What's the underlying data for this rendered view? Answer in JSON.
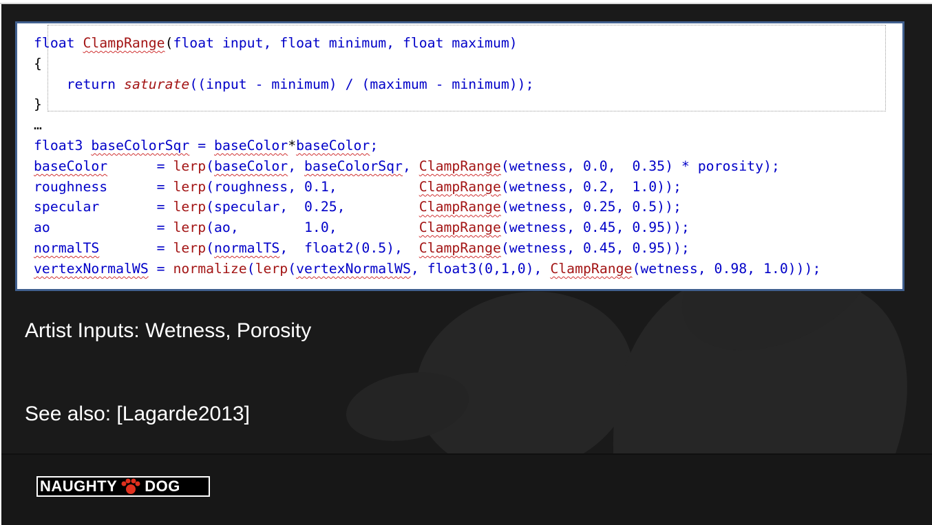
{
  "code": {
    "lines": [
      [
        {
          "t": "float",
          "c": "kw"
        },
        {
          "t": " ",
          "c": ""
        },
        {
          "t": "ClampRange",
          "c": "fn sq"
        },
        {
          "t": "(",
          "c": ""
        },
        {
          "t": "float",
          "c": "kw"
        },
        {
          "t": " input, ",
          "c": "kw"
        },
        {
          "t": "float",
          "c": "kw"
        },
        {
          "t": " minimum, ",
          "c": "kw"
        },
        {
          "t": "float",
          "c": "kw"
        },
        {
          "t": " maximum)",
          "c": "kw"
        }
      ],
      [
        {
          "t": "{",
          "c": ""
        }
      ],
      [
        {
          "t": "    ",
          "c": ""
        },
        {
          "t": "return",
          "c": "kw"
        },
        {
          "t": " ",
          "c": ""
        },
        {
          "t": "saturate",
          "c": "fn it"
        },
        {
          "t": "((input - minimum) / (maximum - minimum));",
          "c": "kw"
        }
      ],
      [
        {
          "t": "}",
          "c": ""
        }
      ],
      [
        {
          "t": "…",
          "c": ""
        }
      ],
      [
        {
          "t": "float3",
          "c": "kw"
        },
        {
          "t": " ",
          "c": ""
        },
        {
          "t": "baseColorSqr",
          "c": "kw sq"
        },
        {
          "t": " = ",
          "c": "kw"
        },
        {
          "t": "baseColor",
          "c": "kw sq"
        },
        {
          "t": "*",
          "c": ""
        },
        {
          "t": "baseColor",
          "c": "kw sq"
        },
        {
          "t": ";",
          "c": "kw"
        }
      ],
      [
        {
          "t": "baseColor",
          "c": "kw sq"
        },
        {
          "t": "      = ",
          "c": "kw"
        },
        {
          "t": "lerp",
          "c": "fn"
        },
        {
          "t": "(",
          "c": "kw"
        },
        {
          "t": "baseColor",
          "c": "kw sq"
        },
        {
          "t": ", ",
          "c": "kw"
        },
        {
          "t": "baseColorSqr",
          "c": "kw sq"
        },
        {
          "t": ", ",
          "c": "kw"
        },
        {
          "t": "ClampRange",
          "c": "fn sq"
        },
        {
          "t": "(wetness, 0.0,  0.35) * porosity);",
          "c": "kw"
        }
      ],
      [
        {
          "t": "roughness      = ",
          "c": "kw"
        },
        {
          "t": "lerp",
          "c": "fn"
        },
        {
          "t": "(roughness, 0.1,          ",
          "c": "kw"
        },
        {
          "t": "ClampRange",
          "c": "fn sq"
        },
        {
          "t": "(wetness, 0.2,  1.0));",
          "c": "kw"
        }
      ],
      [
        {
          "t": "specular       = ",
          "c": "kw"
        },
        {
          "t": "lerp",
          "c": "fn"
        },
        {
          "t": "(specular,  0.25,         ",
          "c": "kw"
        },
        {
          "t": "ClampRange",
          "c": "fn sq"
        },
        {
          "t": "(wetness, 0.25, 0.5));",
          "c": "kw"
        }
      ],
      [
        {
          "t": "ao             = ",
          "c": "kw"
        },
        {
          "t": "lerp",
          "c": "fn"
        },
        {
          "t": "(ao,        1.0,          ",
          "c": "kw"
        },
        {
          "t": "ClampRange",
          "c": "fn sq"
        },
        {
          "t": "(wetness, 0.45, 0.95));",
          "c": "kw"
        }
      ],
      [
        {
          "t": "normalTS",
          "c": "kw sq"
        },
        {
          "t": "       = ",
          "c": "kw"
        },
        {
          "t": "lerp",
          "c": "fn"
        },
        {
          "t": "(",
          "c": "kw"
        },
        {
          "t": "normalTS",
          "c": "kw sq"
        },
        {
          "t": ",  ",
          "c": "kw"
        },
        {
          "t": "float2",
          "c": "kw"
        },
        {
          "t": "(0.5),  ",
          "c": "kw"
        },
        {
          "t": "ClampRange",
          "c": "fn sq"
        },
        {
          "t": "(wetness, 0.45, 0.95));",
          "c": "kw"
        }
      ],
      [
        {
          "t": "vertexNormalWS",
          "c": "kw sq"
        },
        {
          "t": " = ",
          "c": "kw"
        },
        {
          "t": "normalize",
          "c": "fn"
        },
        {
          "t": "(",
          "c": "kw"
        },
        {
          "t": "lerp",
          "c": "fn"
        },
        {
          "t": "(",
          "c": "kw"
        },
        {
          "t": "vertexNormalWS",
          "c": "kw sq"
        },
        {
          "t": ", ",
          "c": "kw"
        },
        {
          "t": "float3",
          "c": "kw"
        },
        {
          "t": "(0,1,0), ",
          "c": "kw"
        },
        {
          "t": "ClampRange",
          "c": "fn sq"
        },
        {
          "t": "(wetness, 0.98, 1.0)));",
          "c": "kw"
        }
      ]
    ]
  },
  "captions": {
    "artist_inputs": "Artist Inputs: Wetness, Porosity",
    "see_also": "See also: [Lagarde2013]"
  },
  "logo": {
    "left_word": "NAUGHTY",
    "right_word": "DOG",
    "paw_icon": "paw-print-icon"
  },
  "colors": {
    "background": "#1a1a1a",
    "code_border": "#41608f",
    "keyword": "#0000c8",
    "function": "#a31515",
    "logo_paw": "#e0301e"
  }
}
